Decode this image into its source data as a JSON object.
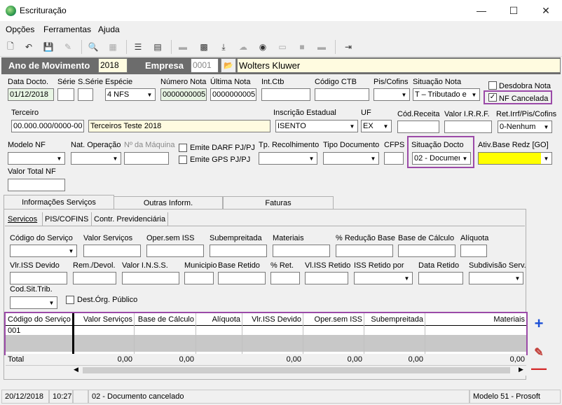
{
  "window": {
    "title": "Escrituração"
  },
  "menu": [
    "Opções",
    "Ferramentas",
    "Ajuda"
  ],
  "header": {
    "ano_label": "Ano de Movimento",
    "ano_value": "2018",
    "empresa_label": "Empresa",
    "empresa_code": "0001",
    "empresa_name": "Wolters Kluwer"
  },
  "form": {
    "data_docto": {
      "label": "Data Docto.",
      "value": "01/12/2018"
    },
    "serie": {
      "label": "Série",
      "value": ""
    },
    "sserie": {
      "label": "S.Série",
      "value": ""
    },
    "especie": {
      "label": "Espécie",
      "value": "4 NFS"
    },
    "numero_nota": {
      "label": "Número Nota",
      "value": "0000000005"
    },
    "ultima_nota": {
      "label": "Última Nota",
      "value": "0000000005"
    },
    "int_ctb": {
      "label": "Int.Ctb",
      "value": ""
    },
    "codigo_ctb": {
      "label": "Código CTB",
      "value": ""
    },
    "pis_cofins": {
      "label": "Pis/Cofins",
      "value": ""
    },
    "situacao_nota": {
      "label": "Situação Nota",
      "value": "T – Tributado e"
    },
    "desdobra_nota": {
      "label": "Desdobra Nota",
      "checked": false
    },
    "nf_cancelada": {
      "label": "NF Cancelada",
      "checked": true
    },
    "terceiro": {
      "label": "Terceiro",
      "code": "00.000.000/0000-00",
      "name": "Terceiros Teste 2018"
    },
    "inscricao_estadual": {
      "label": "Inscrição Estadual",
      "value": "ISENTO"
    },
    "uf": {
      "label": "UF",
      "value": "EX"
    },
    "cod_receita": {
      "label": "Cód.Receita",
      "value": ""
    },
    "valor_irrf": {
      "label": "Valor I.R.R.F.",
      "value": ""
    },
    "ret_irrf": {
      "label": "Ret.Irrf/Pis/Cofins",
      "value": "0-Nenhum"
    },
    "modelo_nf": {
      "label": "Modelo NF",
      "value": ""
    },
    "nat_operacao": {
      "label": "Nat. Operação",
      "value": ""
    },
    "n_maquina": {
      "label": "Nº da Máquina",
      "value": ""
    },
    "emite_darf": {
      "label": "Emite DARF PJ/PJ",
      "checked": false
    },
    "emite_gps": {
      "label": "Emite GPS PJ/PJ",
      "checked": false
    },
    "tp_recolhimento": {
      "label": "Tp. Recolhimento",
      "value": ""
    },
    "tipo_documento": {
      "label": "Tipo Documento",
      "value": ""
    },
    "cfps": {
      "label": "CFPS",
      "value": ""
    },
    "situacao_docto": {
      "label": "Situação Docto",
      "value": "02 - Documer"
    },
    "ativ_base": {
      "label": "Ativ.Base Redz [GO]",
      "value": ""
    },
    "valor_total_nf": {
      "label": "Valor Total NF",
      "value": ""
    }
  },
  "tabs": [
    "Informações Serviços",
    "Outras Inform.",
    "Faturas"
  ],
  "subtabs": [
    "Servicos",
    "PIS/COFINS",
    "Contr. Previdenciária"
  ],
  "servicos": {
    "row1": [
      "Código do Serviço",
      "Valor Serviços",
      "Oper.sem ISS",
      "Subempreitada",
      "Materiais",
      "% Redução Base",
      "Base de Cálculo",
      "Alíquota"
    ],
    "row2": [
      "Vlr.ISS Devido",
      "Rem./Devol.",
      "Valor I.N.S.S.",
      "Municipio",
      "Base Retido",
      "% Ret.",
      "Vl.ISS Retido",
      "ISS Retido por",
      "Data Retido",
      "Subdivisão Serv."
    ],
    "cod_sit_trib": "Cod.Sit.Trib.",
    "dest_org": "Dest.Órg. Público"
  },
  "grid": {
    "columns": [
      "Código do Serviço",
      "Valor Serviços",
      "Base de Cálculo",
      "Alíquota",
      "Vlr.ISS Devido",
      "Oper.sem ISS",
      "Subempreitada",
      "Materiais"
    ],
    "rows": [
      [
        "001",
        "",
        "",
        "",
        "",
        "",
        "",
        ""
      ]
    ],
    "total_label": "Total",
    "totals": [
      "0,00",
      "0,00",
      "",
      "0,00",
      "0,00",
      "0,00",
      "0,00"
    ]
  },
  "status": {
    "date": "20/12/2018",
    "time": "10:27",
    "message": "02 - Documento cancelado",
    "model": "Modelo 51 - Prosoft"
  },
  "colors": {
    "highlight": "#9b4aa8",
    "band": "#6c6c6c",
    "yellow": "#ffff00",
    "add": "#1a4fd6",
    "remove": "#d42a2a"
  }
}
